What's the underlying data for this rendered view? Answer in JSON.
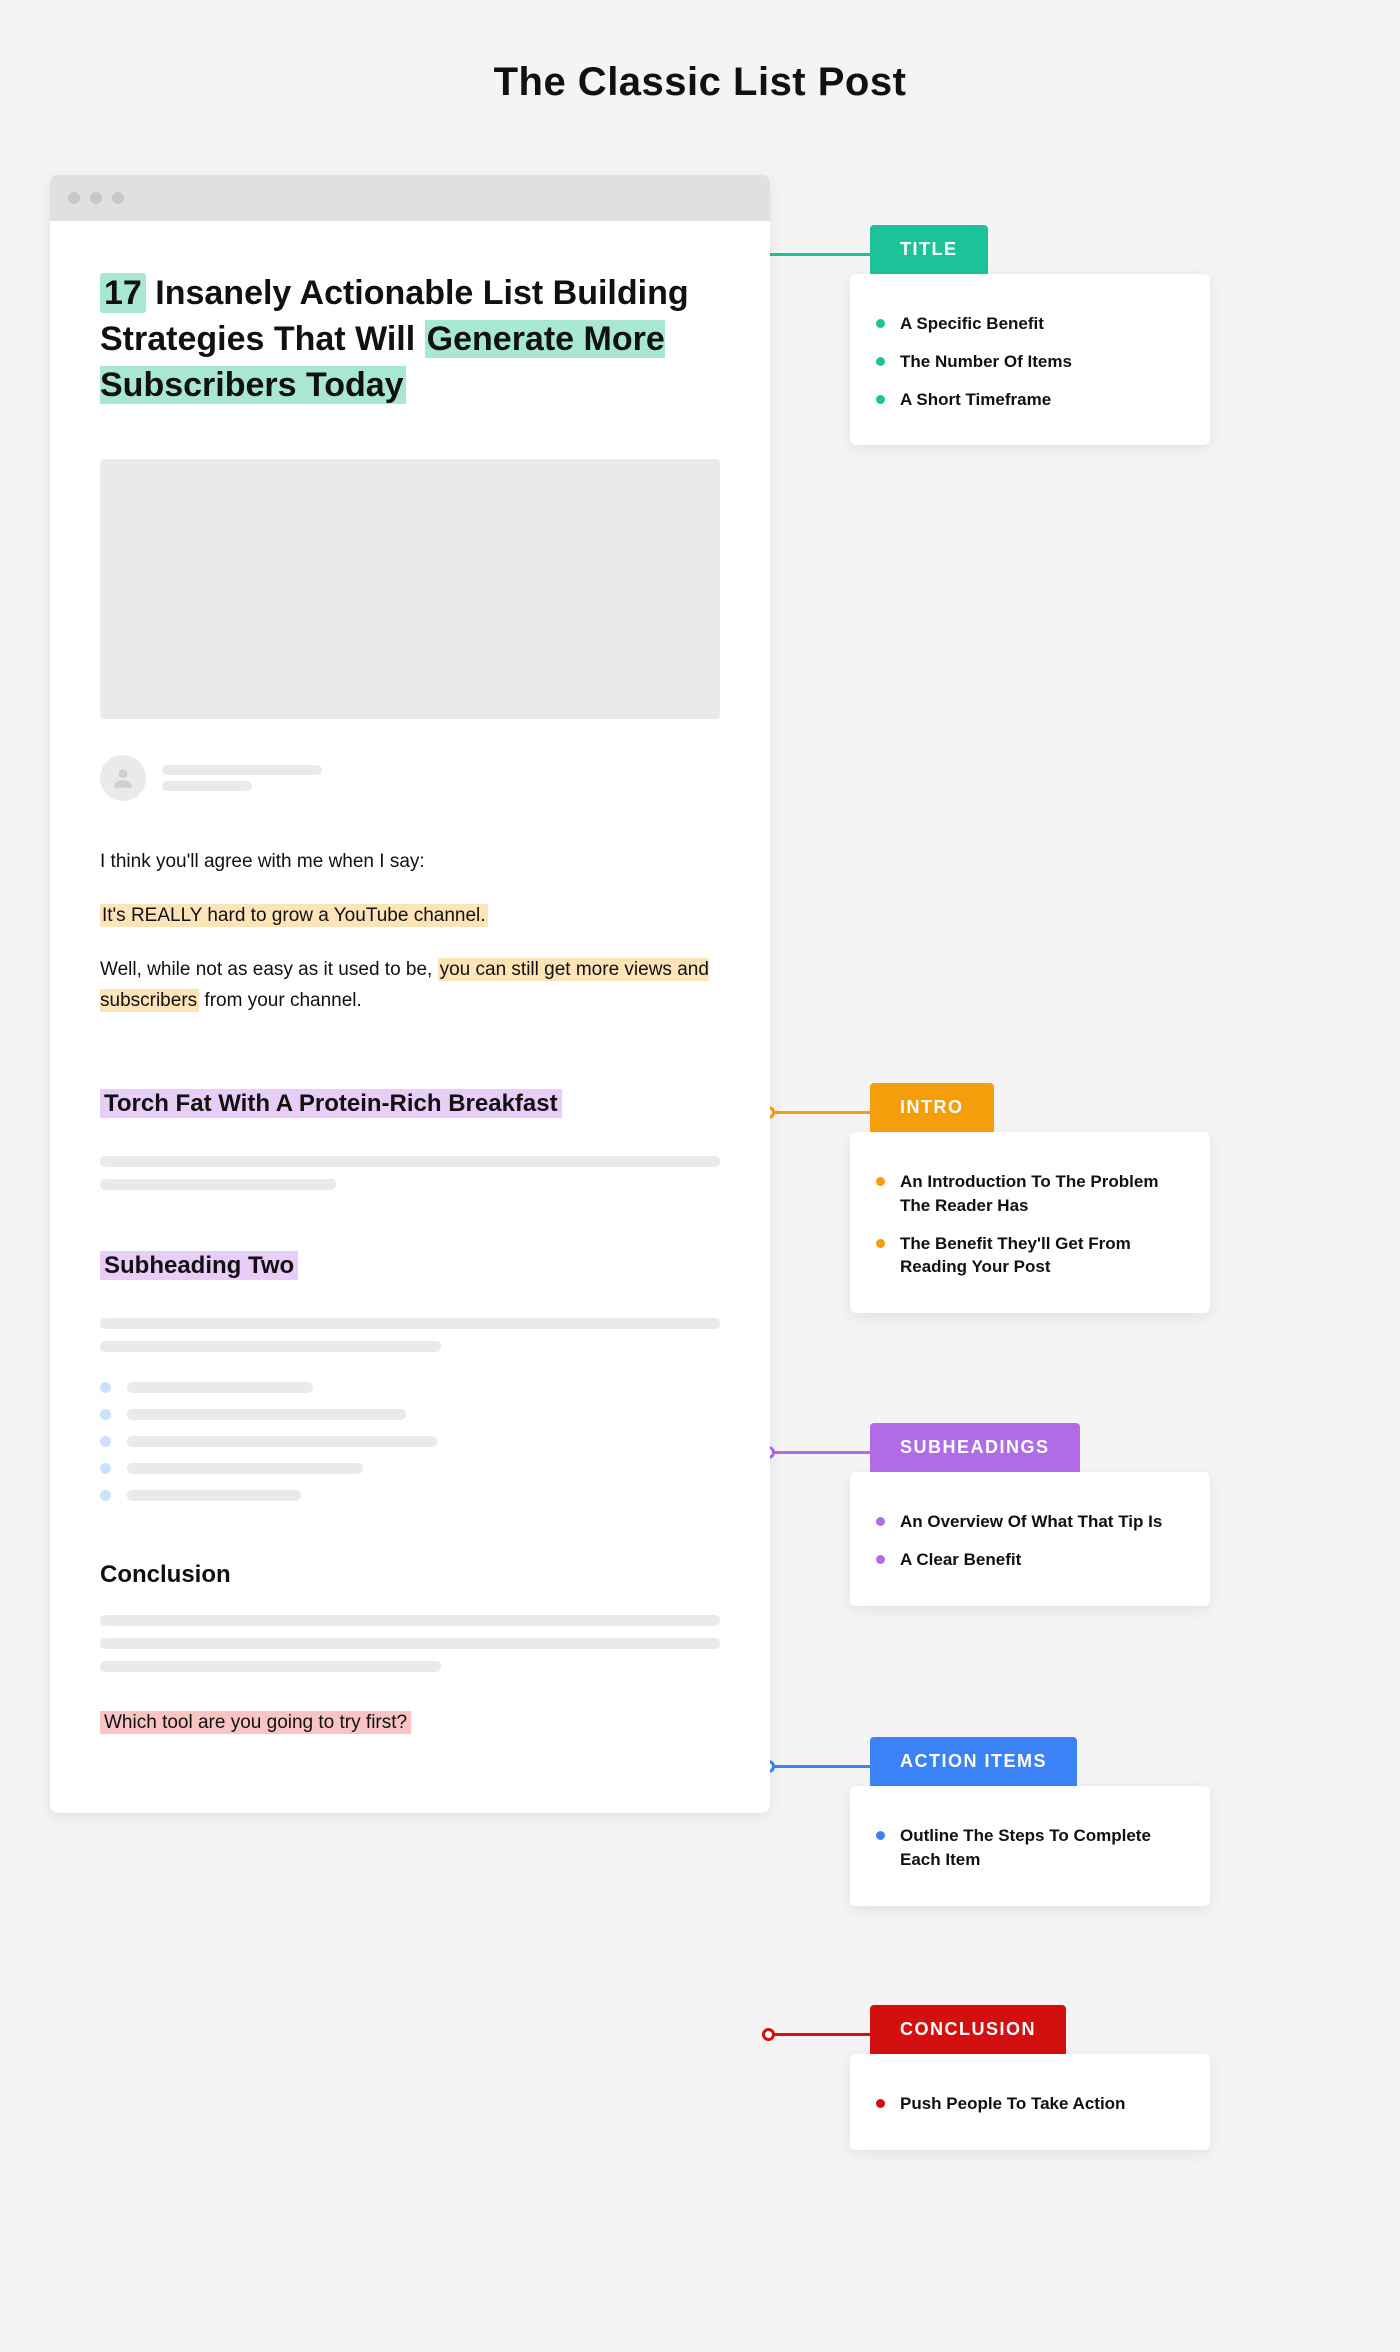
{
  "page_title": "The Classic List Post",
  "post": {
    "title_number": "17",
    "title_plain_1": " Insanely Actionable List Building Strategies That Will ",
    "title_highlight_2": "Generate More Subscribers Today",
    "intro_line_1": "I think you'll agree with me when I say:",
    "intro_highlight_1": "It's REALLY hard to grow a YouTube channel.",
    "intro_line_2_a": "Well, while not as easy as it used to be, ",
    "intro_line_2_hl": "you can still get more views and subscribers",
    "intro_line_2_b": " from your channel.",
    "subheading_1": "Torch Fat With A Protein-Rich Breakfast",
    "subheading_2": "Subheading Two",
    "conclusion_heading": "Conclusion",
    "closing_question": "Which tool are you going to try first?"
  },
  "annotations": {
    "title": {
      "label": "TITLE",
      "items": [
        "A Specific Benefit",
        "The Number Of Items",
        "A Short Timeframe"
      ]
    },
    "intro": {
      "label": "INTRO",
      "items": [
        "An Introduction To The Problem The Reader Has",
        "The Benefit They'll Get From Reading Your Post"
      ]
    },
    "subheadings": {
      "label": "SUBHEADINGS",
      "items": [
        "An Overview Of What That Tip Is",
        "A Clear Benefit"
      ]
    },
    "action": {
      "label": "ACTION ITEMS",
      "items": [
        "Outline The Steps To Complete Each Item"
      ]
    },
    "conclusion": {
      "label": "CONCLUSION",
      "items": [
        "Push People To Take Action"
      ]
    }
  }
}
